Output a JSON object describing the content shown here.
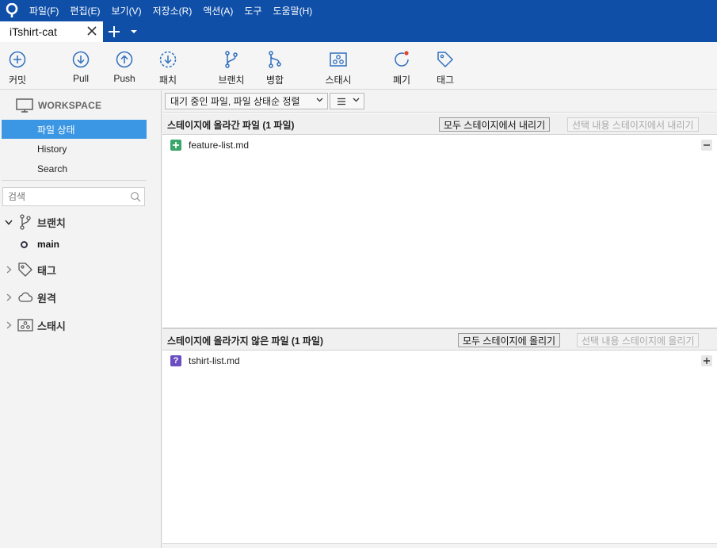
{
  "menu": {
    "items": [
      "파일(F)",
      "편집(E)",
      "보기(V)",
      "저장소(R)",
      "액션(A)",
      "도구",
      "도움말(H)"
    ]
  },
  "tabs": {
    "active_label": "iTshirt-cat"
  },
  "toolbar": {
    "commit": "커밋",
    "pull": "Pull",
    "push": "Push",
    "fetch": "패치",
    "branch": "브랜치",
    "merge": "병합",
    "stash": "스태시",
    "discard": "폐기",
    "tag": "태그"
  },
  "sidebar": {
    "workspace_title": "WORKSPACE",
    "items": [
      "파일 상태",
      "History",
      "Search"
    ],
    "active_item": "파일 상태",
    "search_placeholder": "검색",
    "groups": {
      "branches": "브랜치",
      "tags": "태그",
      "remotes": "원격",
      "stashes": "스태시"
    },
    "current_branch": "main"
  },
  "filter": {
    "selected": "대기 중인 파일, 파일 상태순 정렬",
    "view_mode_icon": "list-icon"
  },
  "staged": {
    "title": "스테이지에 올라간 파일  (1 파일)",
    "unstage_all": "모두 스테이지에서 내리기",
    "unstage_selected": "선택 내용 스테이지에서 내리기",
    "files": [
      {
        "name": "feature-list.md",
        "status": "added"
      }
    ]
  },
  "unstaged": {
    "title": "스테이지에 올라가지 않은 파일  (1 파일)",
    "stage_all": "모두 스테이지에 올리기",
    "stage_selected": "선택 내용 스테이지에 올리기",
    "files": [
      {
        "name": "tshirt-list.md",
        "status": "untracked"
      }
    ]
  },
  "colors": {
    "header_blue": "#0f4fa8",
    "accent_blue": "#2f6fbf",
    "selection": "#3b97e3",
    "added_green": "#3aa66b",
    "untracked_purple": "#6a4ec2",
    "discard_dot": "#e0442d"
  }
}
